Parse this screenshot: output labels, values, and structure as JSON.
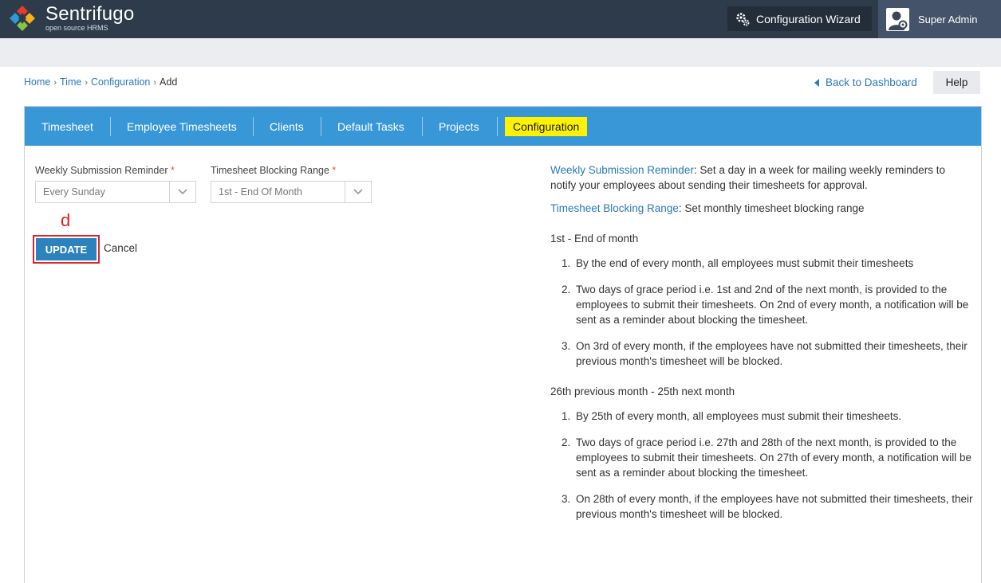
{
  "header": {
    "brand_name": "Sentrifugo",
    "brand_sub": "open source HRMS",
    "wizard_label": "Configuration Wizard",
    "user_name": "Super Admin"
  },
  "breadcrumb": {
    "home": "Home",
    "time": "Time",
    "configuration": "Configuration",
    "current": "Add"
  },
  "actions": {
    "back": "Back to Dashboard",
    "help": "Help"
  },
  "tabs": [
    {
      "label": "Timesheet"
    },
    {
      "label": "Employee Timesheets"
    },
    {
      "label": "Clients"
    },
    {
      "label": "Default Tasks"
    },
    {
      "label": "Projects"
    },
    {
      "label": "Configuration"
    }
  ],
  "form": {
    "weekly_label": "Weekly Submission Reminder",
    "weekly_value": "Every Sunday",
    "blocking_label": "Timesheet Blocking Range",
    "blocking_value": "1st - End Of Month",
    "required_mark": "*",
    "update_label": "UPDATE",
    "cancel_label": "Cancel"
  },
  "annotation": "d",
  "help": {
    "weekly_title": "Weekly Submission Reminder",
    "weekly_desc": ": Set a day in a week for mailing weekly reminders to notify your employees about sending their timesheets for approval.",
    "blocking_title": "Timesheet Blocking Range",
    "blocking_desc": ": Set monthly timesheet blocking range",
    "section1_title": "1st - End of month",
    "section1_items": [
      {
        "num": "1.",
        "text": "By the end of every month, all employees must submit their timesheets"
      },
      {
        "num": "2.",
        "text": "Two days of grace period i.e. 1st and 2nd of the next month, is provided to the employees to submit their timesheets. On 2nd of every month, a notification will be sent as a reminder about blocking the timesheet."
      },
      {
        "num": "3.",
        "text": "On 3rd of every month, if the employees have not submitted their timesheets, their previous month's timesheet will be blocked."
      }
    ],
    "section2_title": "26th previous month - 25th next month",
    "section2_items": [
      {
        "num": "1.",
        "text": "By 25th of every month, all employees must submit their timesheets."
      },
      {
        "num": "2.",
        "text": "Two days of grace period i.e. 27th and 28th of the next month, is provided to the employees to submit their timesheets. On 27th of every month, a notification will be sent as a reminder about blocking the timesheet."
      },
      {
        "num": "3.",
        "text": "On 28th of every month, if the employees have not submitted their timesheets, their previous month's timesheet will be blocked."
      }
    ]
  }
}
